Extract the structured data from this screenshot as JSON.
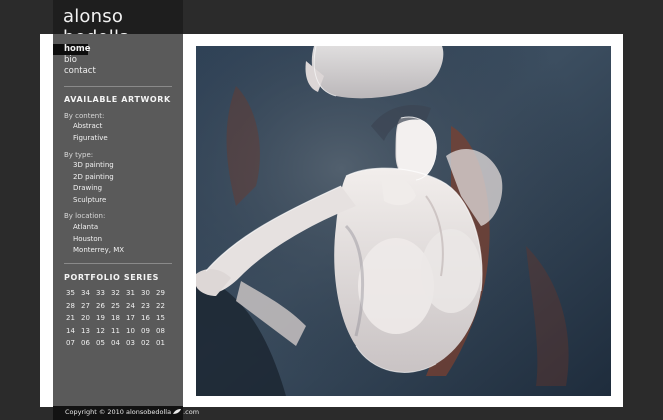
{
  "site": {
    "title": "alonso bedolla"
  },
  "nav": [
    {
      "label": "home",
      "active": true
    },
    {
      "label": "bio"
    },
    {
      "label": "contact"
    }
  ],
  "available_artwork": {
    "title": "AVAILABLE ARTWORK",
    "groups": [
      {
        "label": "By content:",
        "items": [
          "Abstract",
          "Figurative"
        ]
      },
      {
        "label": "By type:",
        "items": [
          "3D painting",
          "2D painting",
          "Drawing",
          "Sculpture"
        ]
      },
      {
        "label": "By location:",
        "items": [
          "Atlanta",
          "Houston",
          "Monterrey, MX"
        ]
      }
    ]
  },
  "portfolio_series": {
    "title": "PORTFOLIO SERIES",
    "rows": [
      [
        "35",
        "34",
        "33",
        "32",
        "31",
        "30",
        "29"
      ],
      [
        "28",
        "27",
        "26",
        "25",
        "24",
        "23",
        "22"
      ],
      [
        "21",
        "20",
        "19",
        "18",
        "17",
        "16",
        "15"
      ],
      [
        "14",
        "13",
        "12",
        "11",
        "10",
        "09",
        "08"
      ],
      [
        "07",
        "06",
        "05",
        "04",
        "03",
        "02",
        "01"
      ]
    ]
  },
  "footer": {
    "copyright_prefix": "Copyright © 2010 alonsobedolla",
    "copyright_suffix": ".com"
  },
  "artwork": {
    "subject": "painting of a nude female figure",
    "colors": {
      "background_blue": "#2a3f55",
      "figure_white": "#ece8e6",
      "rust": "#8a4a33"
    }
  }
}
